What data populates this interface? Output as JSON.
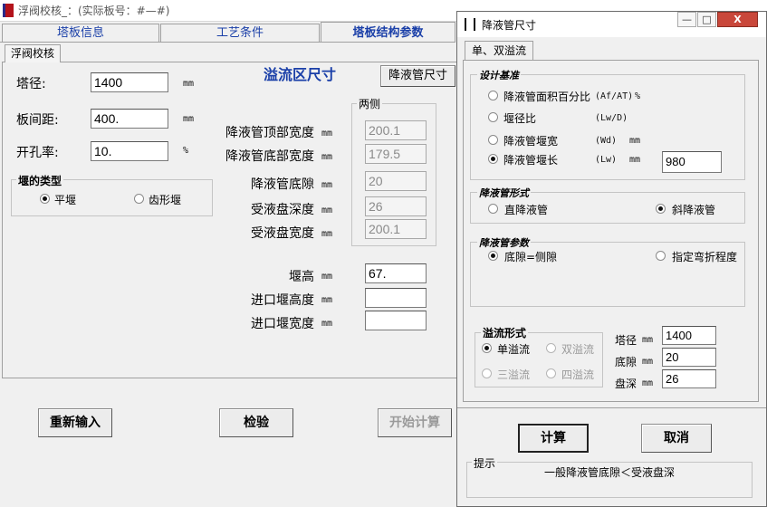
{
  "main_window": {
    "title": "浮阀校核_：(实际板号：#—#)",
    "tabs": [
      {
        "label": "塔板信息",
        "active": false
      },
      {
        "label": "工艺条件",
        "active": false
      },
      {
        "label": "塔板结构参数",
        "active": true
      }
    ],
    "sub_tab": "浮阀校核",
    "left_fields": {
      "diameter": {
        "label": "塔径:",
        "value": "1400",
        "unit": "mm"
      },
      "spacing": {
        "label": "板间距:",
        "value": "400.",
        "unit": "mm"
      },
      "hole_ratio": {
        "label": "开孔率:",
        "value": "10.",
        "unit": "%"
      }
    },
    "weir_type": {
      "title": "堰的类型",
      "options": [
        {
          "label": "平堰",
          "checked": true
        },
        {
          "label": "齿形堰",
          "checked": false
        }
      ]
    },
    "overflow_heading": "溢流区尺寸",
    "downcomer_size_button": "降液管尺寸",
    "two_sides_group": "两侧",
    "overflow_rows": [
      {
        "label": "降液管顶部宽度",
        "unit": "mm",
        "value": "200.1",
        "disabled": true
      },
      {
        "label": "降液管底部宽度",
        "unit": "mm",
        "value": "179.5",
        "disabled": true
      },
      {
        "label": "降液管底隙",
        "unit": "mm",
        "value": "20",
        "disabled": true
      },
      {
        "label": "受液盘深度",
        "unit": "mm",
        "value": "26",
        "disabled": true
      },
      {
        "label": "受液盘宽度",
        "unit": "mm",
        "value": "200.1",
        "disabled": true
      },
      {
        "label": "堰高",
        "unit": "mm",
        "value": "67.",
        "disabled": false
      },
      {
        "label": "进口堰高度",
        "unit": "mm",
        "value": "",
        "disabled": false
      },
      {
        "label": "进口堰宽度",
        "unit": "mm",
        "value": "",
        "disabled": false
      }
    ],
    "buttons": {
      "reset": "重新输入",
      "check": "检验",
      "start": "开始计算"
    }
  },
  "dialog": {
    "title": "降液管尺寸",
    "controls": {
      "minimize": "—",
      "maximize": "□",
      "close": "X"
    },
    "tab": "单、双溢流",
    "design_basis": {
      "title": "设计基准",
      "options": [
        {
          "label": "降液管面积百分比",
          "symbol": "(Af/AT)",
          "unit": "%",
          "checked": false
        },
        {
          "label": "堰径比",
          "symbol": "(Lw/D)",
          "unit": "",
          "checked": false
        },
        {
          "label": "降液管堰宽",
          "symbol": "(Wd)",
          "unit": "mm",
          "checked": false
        },
        {
          "label": "降液管堰长",
          "symbol": "(Lw)",
          "unit": "mm",
          "checked": true
        }
      ],
      "value": "980"
    },
    "downcomer_form": {
      "title": "降液管形式",
      "options": [
        {
          "label": "直降液管",
          "checked": false
        },
        {
          "label": "斜降液管",
          "checked": true
        }
      ]
    },
    "downcomer_params": {
      "title": "降液管参数",
      "options": [
        {
          "label": "底隙=侧隙",
          "checked": true
        },
        {
          "label": "指定弯折程度",
          "checked": false
        }
      ]
    },
    "overflow_form": {
      "title": "溢流形式",
      "options": [
        {
          "label": "单溢流",
          "checked": true,
          "disabled": false
        },
        {
          "label": "双溢流",
          "checked": false,
          "disabled": true
        },
        {
          "label": "三溢流",
          "checked": false,
          "disabled": true
        },
        {
          "label": "四溢流",
          "checked": false,
          "disabled": true
        }
      ]
    },
    "params": [
      {
        "label": "塔径",
        "unit": "mm",
        "value": "1400"
      },
      {
        "label": "底隙",
        "unit": "mm",
        "value": "20"
      },
      {
        "label": "盘深",
        "unit": "mm",
        "value": "26"
      }
    ],
    "buttons": {
      "calc": "计算",
      "cancel": "取消"
    },
    "hint": {
      "title": "提示",
      "text": "一般降液管底隙＜受液盘深"
    }
  }
}
